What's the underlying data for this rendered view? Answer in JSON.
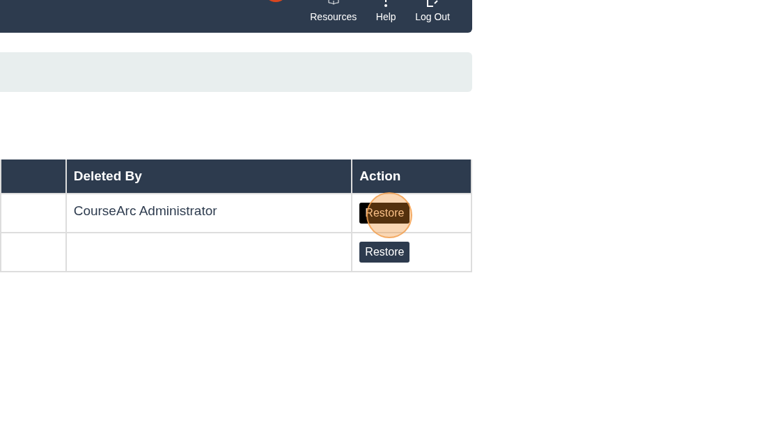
{
  "header": {
    "nav": [
      {
        "label": "Resources",
        "kind": "book"
      },
      {
        "label": "Help",
        "kind": "help"
      },
      {
        "label": "Log Out",
        "kind": "logout"
      }
    ]
  },
  "table": {
    "columns": [
      "Deleted By",
      "Action"
    ],
    "rows": [
      {
        "deleted_by": "CourseArc Administrator",
        "button": "Restore",
        "highlighted": true
      },
      {
        "button": "Restore",
        "highlighted": false
      }
    ]
  }
}
